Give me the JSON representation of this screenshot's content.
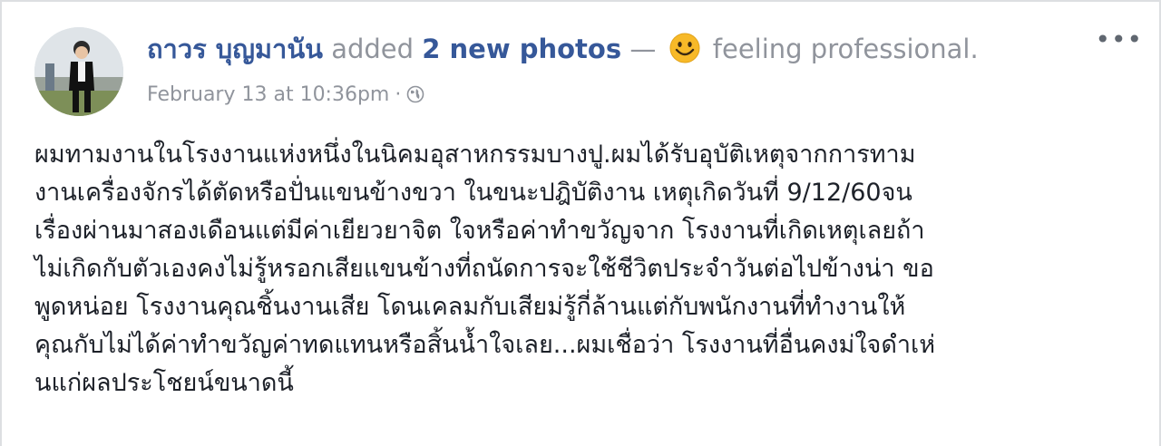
{
  "post": {
    "author_name": "ถาวร บุญมานัน",
    "action_text": "added",
    "photos_count_text": "2 new photos",
    "dash": "—",
    "feeling_text": "feeling professional.",
    "feeling_icon": "smiley-icon",
    "timestamp": "February 13 at 10:36pm",
    "separator": "·",
    "privacy_icon": "globe-icon",
    "more_options": "•••",
    "body_lines": [
      "ผมทามงานในโรงงานแห่งหนึ่งในนิคมอุสาหกรรมบางปู.ผมได้รับอุบัติเหตุจากการทาม",
      "งานเครื่องจักรได้ตัดหรือปั่นแขนข้างขวา ในขนะปฎิบัติงาน เหตุเกิดวันที่ 9/12/60จน",
      "เรื่องผ่านมาสองเดือนแต่มีค่าเยียวยาจิต ใจหรือค่าทำขวัญจาก โรงงานที่เกิดเหตุเลยถ้า",
      "ไม่เกิดกับตัวเองคงไม่รู้หรอกเสียแขนข้างที่ถนัดการจะใช้ชีวิตประจำวันต่อไปข้างน่า ขอ",
      "พูดหน่อย โรงงานคุณชิ้นงานเสีย โดนเคลมกับเสียม่รู้กี่ล้านแต่กับพนักงานที่ทำงานให้",
      "คุณกับไม่ได้ค่าทำขวัญค่าทดแทนหรือสิ้นน้ำใจเลย...ผมเชื่อว่า โรงงานที่อื่นคงม่ใจดำเห่",
      "นแก่ผลประโชยน์ขนาดนี้"
    ]
  },
  "colors": {
    "link": "#365899",
    "meta": "#90949c",
    "text": "#1d2129",
    "emoji": "#f7b928"
  }
}
